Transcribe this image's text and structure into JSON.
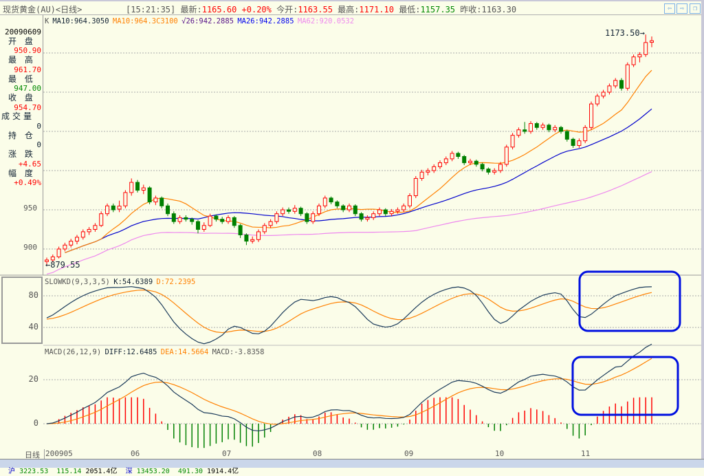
{
  "title": {
    "name": "现货黄金(AU)<日线>",
    "time": "[15:21:35]",
    "latest_label": "最新:",
    "latest": "1165.60",
    "change_pct": "+0.20%",
    "open_label": "今开:",
    "open": "1163.55",
    "high_label": "最高:",
    "high": "1171.10",
    "low_label": "最低:",
    "low": "1157.35",
    "prev_label": "昨收:",
    "prev_close": "1163.30",
    "nav_icons": [
      "arrow-left-icon",
      "arrow-right-icon",
      "restore-window-icon"
    ]
  },
  "info_panel": {
    "date": "20090609",
    "open_label": "开 盘",
    "open": "950.90",
    "high_label": "最 高",
    "high": "961.70",
    "low_label": "最 低",
    "low": "947.00",
    "close_label": "收 盘",
    "close": "954.70",
    "volume_label": "成交量",
    "volume": "0",
    "position_label": "持 仓",
    "position": "0",
    "change_label": "涨 跌",
    "change": "+4.65",
    "range_label": "幅 度",
    "range": "+0.49%"
  },
  "chart_data": [
    {
      "type": "candlestick",
      "legend": {
        "k": "K",
        "ma10a": "MA10:964.3050",
        "ma10b": "MA10:964.3C3100",
        "ma26a": "√26:942.2885",
        "ma26b": "MA26:942.2885",
        "ma62": "MA62:920.0532"
      },
      "colors": {
        "up": "#ff0000",
        "down": "#008000",
        "ma10": "#ff8000",
        "ma26": "#0000cc",
        "ma62": "#ee88ee"
      },
      "y_ticks": [
        "950",
        "900"
      ],
      "ylim": [
        870,
        1190
      ],
      "max_label": "1173.50",
      "min_label": "879.55",
      "x_ticks": [
        "200905",
        "06",
        "07",
        "08",
        "09",
        "10",
        "11"
      ],
      "x_axis_label": "日线",
      "candles_ohlc": [
        [
          884,
          889,
          879.55,
          886
        ],
        [
          886,
          893,
          883,
          890
        ],
        [
          890,
          903,
          888,
          900
        ],
        [
          900,
          908,
          897,
          905
        ],
        [
          905,
          913,
          902,
          910
        ],
        [
          910,
          918,
          906,
          915
        ],
        [
          915,
          925,
          912,
          922
        ],
        [
          922,
          928,
          918,
          925
        ],
        [
          925,
          933,
          922,
          930
        ],
        [
          930,
          948,
          928,
          945
        ],
        [
          945,
          958,
          942,
          955
        ],
        [
          955,
          958,
          947,
          950
        ],
        [
          950.9,
          961.7,
          947,
          954.7
        ],
        [
          955,
          975,
          952,
          972
        ],
        [
          972,
          990,
          968,
          985
        ],
        [
          985,
          988,
          972,
          975
        ],
        [
          975,
          982,
          970,
          978
        ],
        [
          978,
          980,
          957,
          960
        ],
        [
          960,
          968,
          956,
          965
        ],
        [
          965,
          967,
          952,
          955
        ],
        [
          955,
          958,
          942,
          945
        ],
        [
          945,
          948,
          932,
          935
        ],
        [
          935,
          943,
          932,
          940
        ],
        [
          940,
          943,
          935,
          938
        ],
        [
          938,
          940,
          931,
          935
        ],
        [
          935,
          937,
          920,
          925
        ],
        [
          925,
          934,
          922,
          930
        ],
        [
          930,
          945,
          928,
          942
        ],
        [
          942,
          944,
          935,
          938
        ],
        [
          938,
          941,
          932,
          935
        ],
        [
          935,
          943,
          932,
          940
        ],
        [
          940,
          942,
          927,
          930
        ],
        [
          930,
          932,
          914,
          918
        ],
        [
          918,
          920,
          905,
          910
        ],
        [
          910,
          916,
          907,
          912
        ],
        [
          912,
          925,
          909,
          922
        ],
        [
          922,
          933,
          919,
          930
        ],
        [
          930,
          938,
          927,
          935
        ],
        [
          935,
          948,
          932,
          945
        ],
        [
          945,
          953,
          942,
          950
        ],
        [
          950,
          953,
          945,
          948
        ],
        [
          948,
          956,
          945,
          952
        ],
        [
          952,
          954,
          942,
          945
        ],
        [
          945,
          947,
          932,
          935
        ],
        [
          935,
          948,
          932,
          945
        ],
        [
          945,
          958,
          942,
          955
        ],
        [
          955,
          968,
          952,
          965
        ],
        [
          965,
          967,
          957,
          960
        ],
        [
          960,
          962,
          952,
          955
        ],
        [
          955,
          957,
          947,
          950
        ],
        [
          950,
          958,
          947,
          955
        ],
        [
          955,
          957,
          942,
          945
        ],
        [
          945,
          947,
          935,
          938
        ],
        [
          938,
          943,
          935,
          940
        ],
        [
          940,
          948,
          937,
          945
        ],
        [
          945,
          953,
          942,
          950
        ],
        [
          950,
          952,
          942,
          945
        ],
        [
          945,
          951,
          942,
          948
        ],
        [
          948,
          953,
          945,
          950
        ],
        [
          950,
          958,
          947,
          955
        ],
        [
          955,
          971,
          952,
          968
        ],
        [
          968,
          993,
          965,
          990
        ],
        [
          990,
          1001,
          987,
          998
        ],
        [
          998,
          1003,
          994,
          1000
        ],
        [
          1000,
          1008,
          997,
          1005
        ],
        [
          1005,
          1013,
          1002,
          1010
        ],
        [
          1010,
          1018,
          1007,
          1015
        ],
        [
          1015,
          1025,
          1012,
          1022
        ],
        [
          1022,
          1024,
          1015,
          1018
        ],
        [
          1018,
          1020,
          1007,
          1010
        ],
        [
          1010,
          1015,
          1007,
          1012
        ],
        [
          1012,
          1014,
          1005,
          1008
        ],
        [
          1008,
          1010,
          999,
          1002
        ],
        [
          1002,
          1004,
          995,
          998
        ],
        [
          998,
          1003,
          995,
          1000
        ],
        [
          1000,
          1011,
          997,
          1008
        ],
        [
          1008,
          1033,
          1005,
          1030
        ],
        [
          1030,
          1048,
          1027,
          1045
        ],
        [
          1045,
          1055,
          1042,
          1052
        ],
        [
          1052,
          1062,
          1047,
          1050
        ],
        [
          1050,
          1063,
          1047,
          1060
        ],
        [
          1060,
          1062,
          1052,
          1055
        ],
        [
          1055,
          1061,
          1052,
          1058
        ],
        [
          1058,
          1060,
          1049,
          1052
        ],
        [
          1052,
          1058,
          1049,
          1055
        ],
        [
          1055,
          1057,
          1047,
          1050
        ],
        [
          1050,
          1052,
          1037,
          1040
        ],
        [
          1040,
          1042,
          1029,
          1032
        ],
        [
          1032,
          1041,
          1029,
          1038
        ],
        [
          1038,
          1058,
          1035,
          1055
        ],
        [
          1055,
          1088,
          1052,
          1085
        ],
        [
          1085,
          1098,
          1082,
          1095
        ],
        [
          1095,
          1103,
          1092,
          1100
        ],
        [
          1100,
          1111,
          1097,
          1108
        ],
        [
          1108,
          1118,
          1105,
          1115
        ],
        [
          1115,
          1118,
          1102,
          1105
        ],
        [
          1105,
          1138,
          1102,
          1135
        ],
        [
          1135,
          1148,
          1132,
          1145
        ],
        [
          1145,
          1151,
          1138,
          1148
        ],
        [
          1148,
          1173.5,
          1145,
          1163.3
        ],
        [
          1163.55,
          1171.1,
          1157.35,
          1165.6
        ]
      ]
    },
    {
      "type": "line",
      "legend": {
        "name": "SLOWKD(9,3,3,5)",
        "k": "K:54.6389",
        "d": "D:72.2395"
      },
      "colors": {
        "k": "#1a3a5a",
        "d": "#ff8000"
      },
      "y_ticks": [
        "80",
        "40"
      ],
      "ylim": [
        15,
        100
      ]
    },
    {
      "type": "bar",
      "legend": {
        "name": "MACD(26,12,9)",
        "diff": "DIFF:12.6485",
        "dea": "DEA:14.5664",
        "macd": "MACD:-3.8358"
      },
      "colors": {
        "diff": "#1a3a5a",
        "dea": "#ff8000",
        "pos": "#ff0000",
        "neg": "#008000"
      },
      "y_ticks": [
        "20",
        "0"
      ],
      "ylim": [
        -12,
        32
      ]
    }
  ],
  "annotations": {
    "highlight_color": "#0010e0"
  },
  "status_bar": {
    "sh_label": "沪",
    "sh_index": "3223.53",
    "sh_change": "115.14",
    "sh_amount": "2051.4亿",
    "sz_label": "深",
    "sz_index": "13453.20",
    "sz_change": "491.30",
    "sz_amount": "1914.4亿"
  }
}
